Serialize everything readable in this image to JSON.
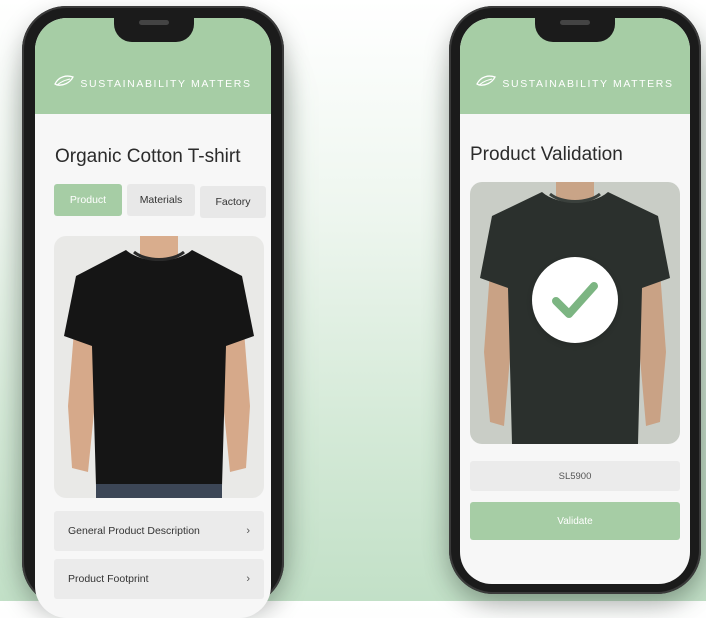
{
  "brand": "SUSTAINABILITY MATTERS",
  "colors": {
    "accent": "#a6cda5",
    "phone": "#1b1b1b",
    "shirt": "#151515",
    "shirt_validate": "#2b302d"
  },
  "left_phone": {
    "title": "Organic Cotton T-shirt",
    "tabs": [
      {
        "label": "Product",
        "active": true
      },
      {
        "label": "Materials",
        "active": false
      },
      {
        "label": "Factory",
        "active": false
      }
    ],
    "sections": [
      {
        "label": "General Product Description",
        "icon": "chevron-right-icon"
      },
      {
        "label": "Product Footprint",
        "icon": "chevron-right-icon"
      }
    ]
  },
  "right_phone": {
    "title": "Product Validation",
    "code_value": "SL5900",
    "validate_label": "Validate",
    "status_icon": "checkmark-icon"
  }
}
